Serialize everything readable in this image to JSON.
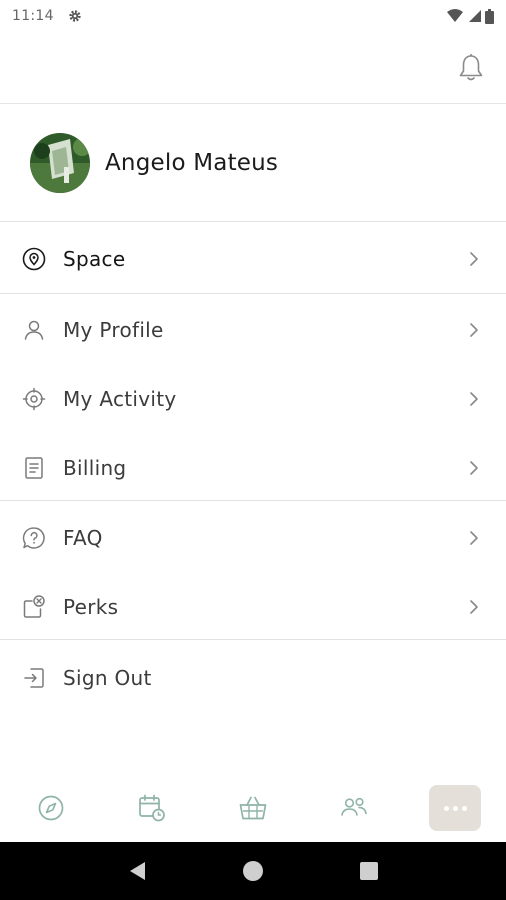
{
  "status_bar": {
    "time": "11:14"
  },
  "profile": {
    "name": "Angelo Mateus"
  },
  "menu": {
    "space": "Space",
    "my_profile": "My Profile",
    "my_activity": "My Activity",
    "billing": "Billing",
    "faq": "FAQ",
    "perks": "Perks",
    "sign_out": "Sign Out"
  },
  "tabs": [
    "explore",
    "bookings",
    "shop",
    "community",
    "more"
  ],
  "colors": {
    "accent": "#8fb3a8",
    "more_bg": "#e5dfda",
    "icon": "#7a7a7a"
  }
}
